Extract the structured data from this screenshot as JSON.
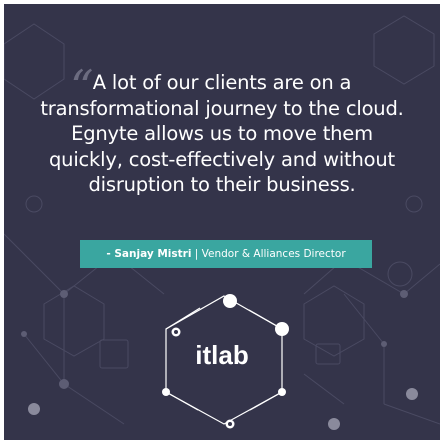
{
  "quote": {
    "lines": [
      "A lot of our clients are on a",
      "transformational journey to the cloud.",
      "Egnyte allows us to move them",
      "quickly, cost-effectively and without",
      "disruption to their business."
    ]
  },
  "attribution": {
    "name": "- Sanjay Mistri",
    "separator": "|",
    "role": "Vendor & Alliances Director"
  },
  "logo": {
    "text": "itlab"
  },
  "colors": {
    "background": "#34344a",
    "accent": "#3aa6a0",
    "text": "#ffffff"
  }
}
